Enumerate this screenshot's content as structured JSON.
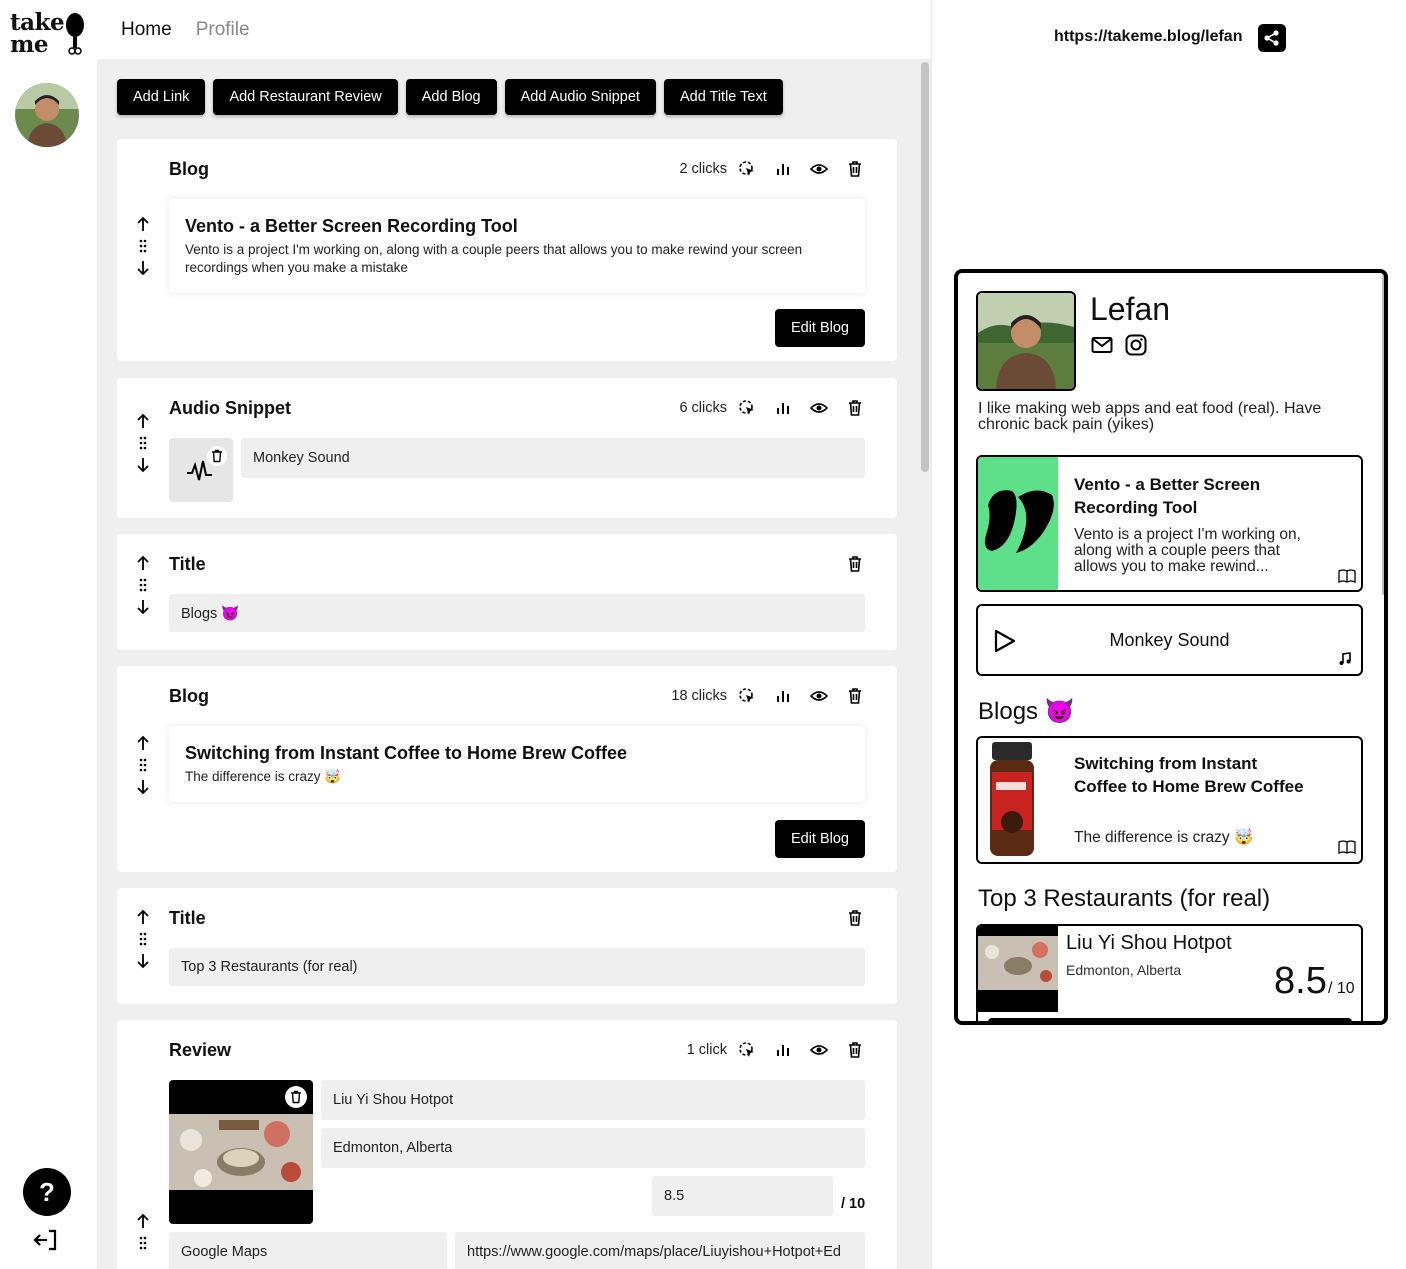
{
  "logo": {
    "line1": "take",
    "line2": "me"
  },
  "nav": {
    "home": "Home",
    "profile": "Profile"
  },
  "toolbar": {
    "add_link": "Add Link",
    "add_review": "Add Restaurant Review",
    "add_blog": "Add Blog",
    "add_audio": "Add Audio Snippet",
    "add_title": "Add Title Text"
  },
  "cards": {
    "blog1": {
      "type_label": "Blog",
      "clicks": "2 clicks",
      "title": "Vento - a Better Screen Recording Tool",
      "description": "Vento is a project I'm working on, along with a couple peers that allows you to make rewind your screen recordings when you make a mistake",
      "edit_label": "Edit Blog"
    },
    "audio": {
      "type_label": "Audio Snippet",
      "clicks": "6 clicks",
      "name": "Monkey Sound"
    },
    "title1": {
      "type_label": "Title",
      "value": "Blogs 😈"
    },
    "blog2": {
      "type_label": "Blog",
      "clicks": "18 clicks",
      "title": "Switching from Instant Coffee to Home Brew Coffee",
      "description": "The difference is crazy 🤯",
      "edit_label": "Edit Blog"
    },
    "title2": {
      "type_label": "Title",
      "value": "Top 3 Restaurants (for real)"
    },
    "review": {
      "type_label": "Review",
      "clicks": "1 click",
      "name": "Liu Yi Shou Hotpot",
      "location": "Edmonton, Alberta",
      "score": "8.5",
      "score_suffix": "/ 10",
      "link_label": "Google Maps",
      "link_url": "https://www.google.com/maps/place/Liuyishou+Hotpot+Ed"
    }
  },
  "help": "?",
  "preview": {
    "url": "https://takeme.blog/lefan",
    "name": "Lefan",
    "bio": "I like making web apps and eat food (real). Have chronic back pain (yikes)",
    "blog1_title": "Vento - a Better Screen Recording Tool",
    "blog1_desc": "Vento is a project I'm working on, along with a couple peers that allows you to make rewind...",
    "audio_name": "Monkey Sound",
    "heading1": "Blogs 😈",
    "blog2_title": "Switching from Instant Coffee to Home Brew Coffee",
    "blog2_desc": "The difference is crazy 🤯",
    "heading2": "Top 3 Restaurants (for real)",
    "review_name": "Liu Yi Shou Hotpot",
    "review_location": "Edmonton, Alberta",
    "review_score": "8.5",
    "review_suffix": "/ 10"
  },
  "colors": {
    "accent_green": "#5ee08a",
    "black": "#000000",
    "editor_bg": "#efefef"
  },
  "icons": [
    "chef-drum-logo-icon",
    "question-icon",
    "logout-icon",
    "click-cursor-icon",
    "bar-chart-icon",
    "eye-icon",
    "trash-icon",
    "arrow-up-icon",
    "arrow-down-icon",
    "drag-handle-icon",
    "waveform-icon",
    "share-icon",
    "mail-icon",
    "instagram-icon",
    "book-icon",
    "play-icon",
    "music-note-icon"
  ]
}
